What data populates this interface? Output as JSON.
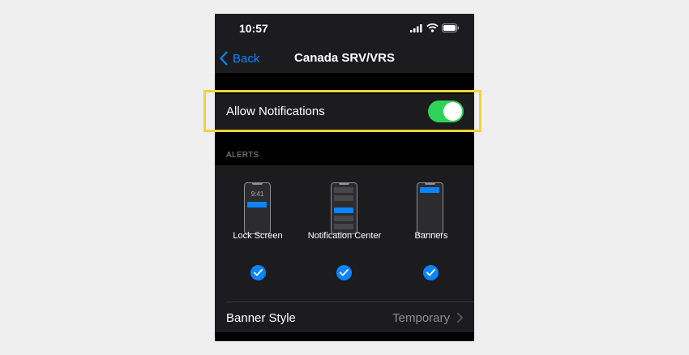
{
  "status_bar": {
    "time": "10:57"
  },
  "nav": {
    "back_label": "Back",
    "title": "Canada SRV/VRS"
  },
  "allow_notifications": {
    "label": "Allow Notifications",
    "enabled": true
  },
  "alerts": {
    "header": "ALERTS",
    "lock_screen_time": "9:41",
    "options": [
      {
        "label": "Lock Screen",
        "checked": true
      },
      {
        "label": "Notification Center",
        "checked": true
      },
      {
        "label": "Banners",
        "checked": true
      }
    ]
  },
  "banner_style": {
    "label": "Banner Style",
    "value": "Temporary"
  },
  "colors": {
    "accent": "#0a84ff",
    "toggle_on": "#30d158",
    "highlight": "#f2d338"
  }
}
